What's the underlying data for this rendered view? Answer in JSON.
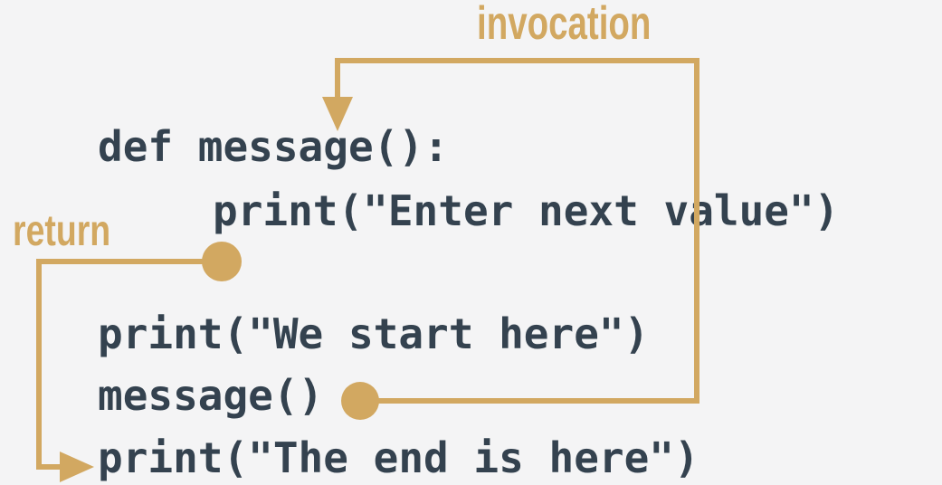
{
  "labels": {
    "invocation": "invocation",
    "return": "return"
  },
  "code": {
    "line1": "def message():",
    "line2": "print(\"Enter next value\")",
    "line3": "print(\"We start here\")",
    "line4": "message()",
    "line5": "print(\"The end is here\")"
  },
  "colors": {
    "accent": "#d2a861",
    "code": "#34424f",
    "background": "#f4f4f5"
  }
}
